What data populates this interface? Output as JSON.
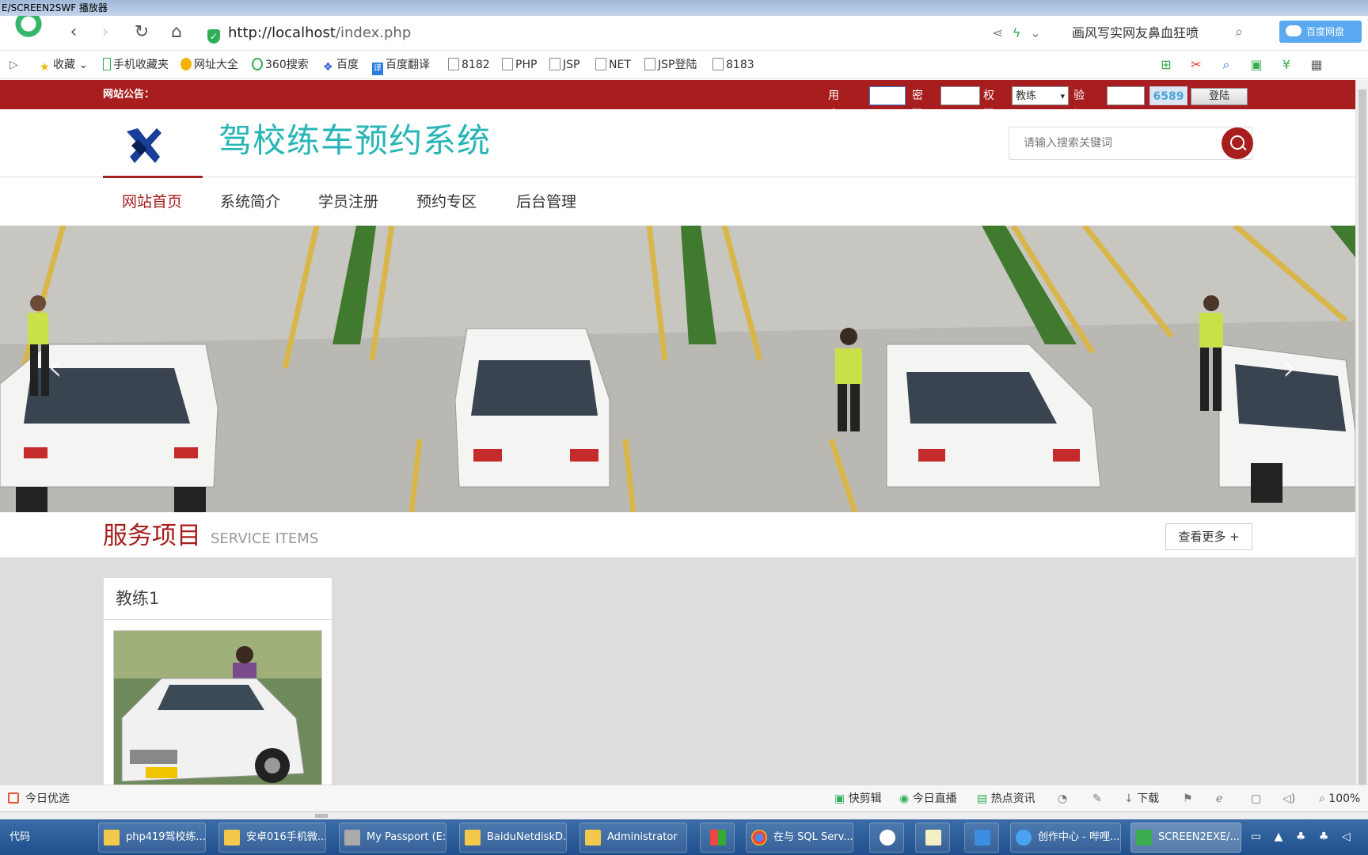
{
  "window": {
    "title": "E/SCREEN2SWF 播放器"
  },
  "browser": {
    "url_host": "http://localhost",
    "url_path": "/index.php",
    "news_text": "画风写实网友鼻血狂喷",
    "cloud_label": "百度网盘"
  },
  "bookmarks": [
    {
      "label": "收藏",
      "icon": "star-icon"
    },
    {
      "label": "手机收藏夹",
      "icon": "phone-icon"
    },
    {
      "label": "网址大全",
      "icon": "plus-circle-icon"
    },
    {
      "label": "360搜索",
      "icon": "search-ring-icon"
    },
    {
      "label": "百度",
      "icon": "baidu-paw-icon"
    },
    {
      "label": "百度翻译",
      "icon": "translate-icon"
    },
    {
      "label": "8182",
      "icon": "file-icon"
    },
    {
      "label": "PHP",
      "icon": "file-icon"
    },
    {
      "label": "JSP",
      "icon": "file-icon"
    },
    {
      "label": "NET",
      "icon": "file-icon"
    },
    {
      "label": "JSP登陆",
      "icon": "file-icon"
    },
    {
      "label": "8183",
      "icon": "file-icon"
    }
  ],
  "site": {
    "notice_label": "网站公告：",
    "login": {
      "username_label": "用户名",
      "password_label": "密码",
      "role_label": "权限",
      "role_value": "教练",
      "captcha_label": "验证码",
      "captcha_code": "6589",
      "submit_label": "登陆"
    },
    "title": "驾校练车预约系统",
    "search_placeholder": "请输入搜索关键词",
    "nav": [
      "网站首页",
      "系统简介",
      "学员注册",
      "预约专区",
      "后台管理"
    ],
    "banner_slides": 3,
    "banner_active_slide": 1,
    "services": {
      "title": "服务项目",
      "subtitle": "SERVICE ITEMS",
      "more_label": "查看更多 +",
      "cards": [
        {
          "title": "教练1"
        }
      ]
    },
    "colors": {
      "brand_red": "#a81d1d",
      "title_teal": "#27b5b6"
    }
  },
  "statusbar": {
    "left": "今日优选",
    "items": [
      "快剪辑",
      "今日直播",
      "热点资讯",
      "下载"
    ],
    "zoom": "100%"
  },
  "taskbar": {
    "code_label": "代码",
    "items": [
      "php419驾校练...",
      "安卓016手机微...",
      "My Passport (E:)",
      "BaiduNetdiskD...",
      "Administrator",
      "在与 SQL Serv...",
      "创作中心 - 哔哩...",
      "SCREEN2EXE/..."
    ]
  }
}
